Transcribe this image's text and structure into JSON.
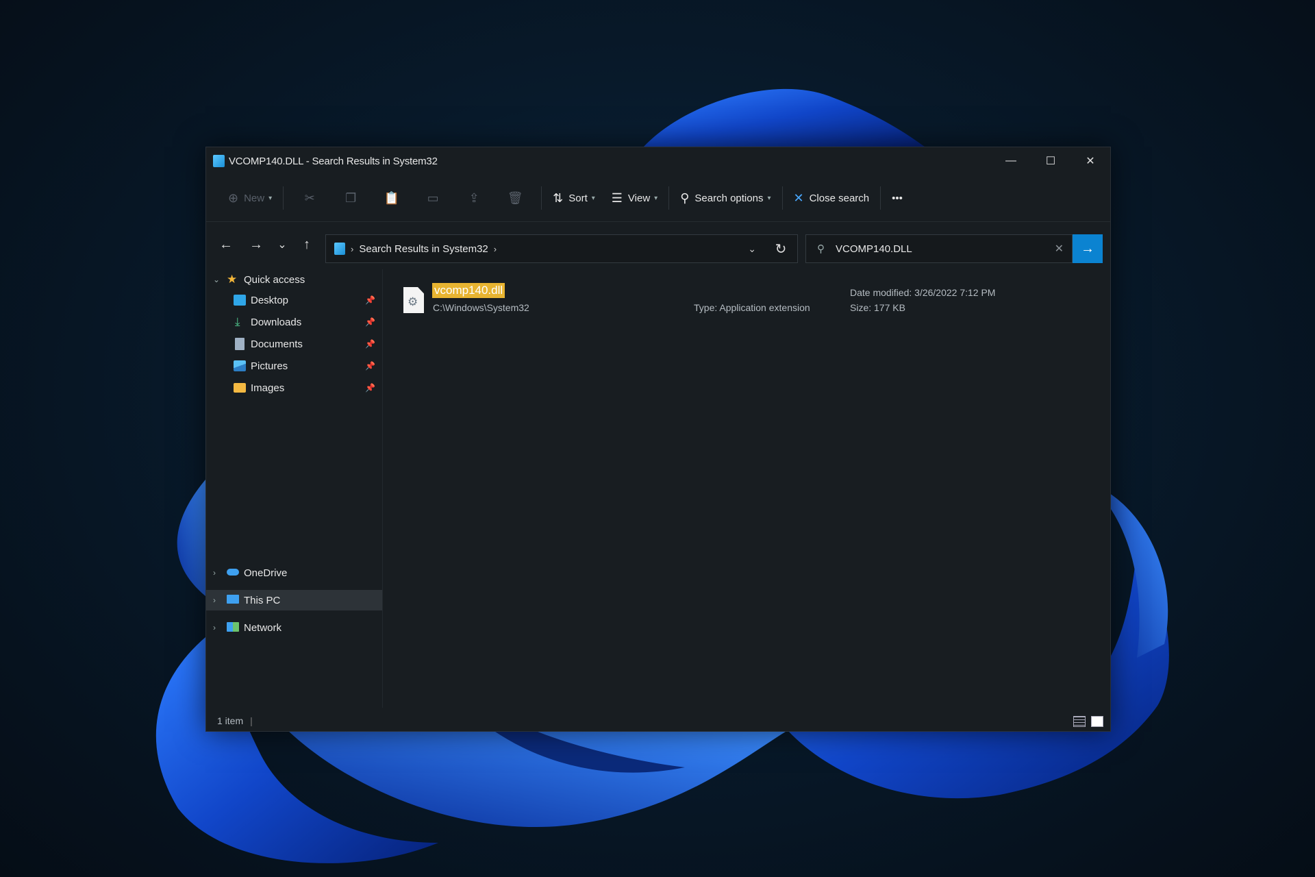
{
  "window": {
    "title": "VCOMP140.DLL - Search Results in System32",
    "controls": {
      "minimize": "—",
      "maximize": "☐",
      "close": "✕"
    }
  },
  "toolbar": {
    "new_label": "New",
    "sort_label": "Sort",
    "view_label": "View",
    "search_options_label": "Search options",
    "close_search_label": "Close search",
    "more_label": "•••"
  },
  "navigation": {
    "back": "←",
    "forward": "→",
    "recent": "⌄",
    "up": "↑",
    "breadcrumb": "Search Results in System32",
    "refresh": "↻"
  },
  "search": {
    "value": "VCOMP140.DLL",
    "clear": "✕",
    "go": "→"
  },
  "sidebar": {
    "quick_access": "Quick access",
    "items": [
      {
        "label": "Desktop",
        "icon": "desktop-icon"
      },
      {
        "label": "Downloads",
        "icon": "downloads-icon"
      },
      {
        "label": "Documents",
        "icon": "documents-icon"
      },
      {
        "label": "Pictures",
        "icon": "pictures-icon"
      },
      {
        "label": "Images",
        "icon": "folder-icon"
      }
    ],
    "onedrive": "OneDrive",
    "this_pc": "This PC",
    "network": "Network"
  },
  "results": [
    {
      "name": "vcomp140.dll",
      "path": "C:\\Windows\\System32",
      "type": "Type: Application extension",
      "date_modified": "Date modified: 3/26/2022 7:12 PM",
      "size": "Size: 177 KB"
    }
  ],
  "status": {
    "item_count": "1 item",
    "separator": "|"
  },
  "colors": {
    "accent": "#0b83d1",
    "highlight": "#e8b431",
    "window_bg": "#181d21"
  }
}
